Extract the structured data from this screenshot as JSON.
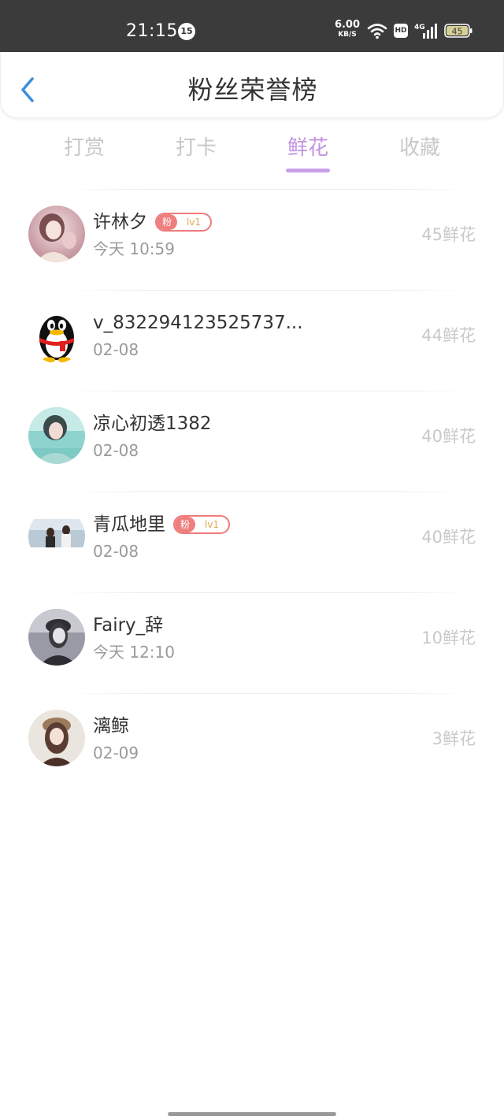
{
  "status_bar": {
    "time": "21:15",
    "notification_count": "15",
    "net_speed_value": "6.00",
    "net_speed_unit": "KB/S",
    "hd_label": "HD",
    "network_label": "4G",
    "battery_level": "45",
    "icons": [
      "wifi-icon",
      "hd-icon",
      "signal-icon",
      "battery-icon"
    ]
  },
  "header": {
    "title": "粉丝荣誉榜",
    "back_icon": "chevron-left-icon",
    "accent_color": "#3a8fe0"
  },
  "tabs": {
    "items": [
      {
        "label": "打赏",
        "active": false
      },
      {
        "label": "打卡",
        "active": false
      },
      {
        "label": "鲜花",
        "active": true
      },
      {
        "label": "收藏",
        "active": false
      }
    ],
    "active_color": "#c293e0",
    "inactive_color": "#c8c8c8"
  },
  "fans": {
    "items": [
      {
        "name": "许林夕",
        "badge_fan": "粉",
        "badge_level": "lv1",
        "time": "今天 10:59",
        "count": "45鲜花"
      },
      {
        "name": "v_832294123525737...",
        "time": "02-08",
        "count": "44鲜花"
      },
      {
        "name": "凉心初透1382",
        "time": "02-08",
        "count": "40鲜花"
      },
      {
        "name": "青瓜地里",
        "badge_fan": "粉",
        "badge_level": "lv1",
        "time": "02-08",
        "count": "40鲜花"
      },
      {
        "name": "Fairy_辞",
        "time": "今天 12:10",
        "count": "10鲜花"
      },
      {
        "name": "漓鲸",
        "time": "02-09",
        "count": "3鲜花"
      }
    ]
  }
}
